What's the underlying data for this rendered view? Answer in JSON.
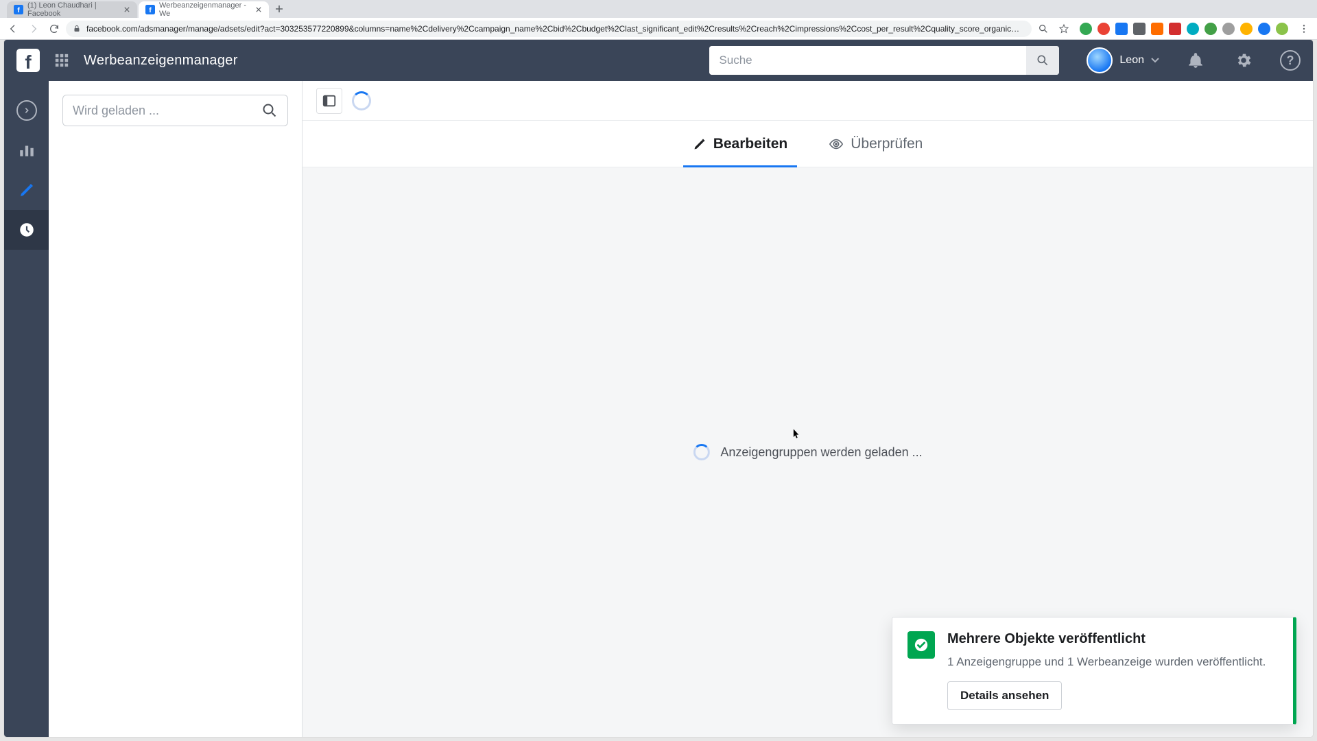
{
  "browser": {
    "tabs": [
      {
        "title": "(1) Leon Chaudhari | Facebook",
        "active": false
      },
      {
        "title": "Werbeanzeigenmanager - We",
        "active": true
      }
    ],
    "url": "facebook.com/adsmanager/manage/adsets/edit?act=303253577220899&columns=name%2Cdelivery%2Ccampaign_name%2Cbid%2Cbudget%2Clast_significant_edit%2Cresults%2Creach%2Cimpressions%2Ccost_per_result%2Cquality_score_organic%2Cquality_score_ectr%2Cquality_score_ecvr…"
  },
  "header": {
    "app_title": "Werbeanzeigenmanager",
    "search_placeholder": "Suche",
    "user_name": "Leon"
  },
  "sidebar": {
    "search_placeholder": "Wird geladen ..."
  },
  "tabs": {
    "edit": "Bearbeiten",
    "review": "Überprüfen"
  },
  "main": {
    "loading_text": "Anzeigengruppen werden geladen ..."
  },
  "toast": {
    "title": "Mehrere Objekte veröffentlicht",
    "body": "1 Anzeigengruppe und 1 Werbeanzeige wurden veröffentlicht.",
    "button": "Details ansehen"
  },
  "colors": {
    "accent": "#1877f2",
    "success": "#00a651",
    "header_bg": "#3a4558"
  }
}
